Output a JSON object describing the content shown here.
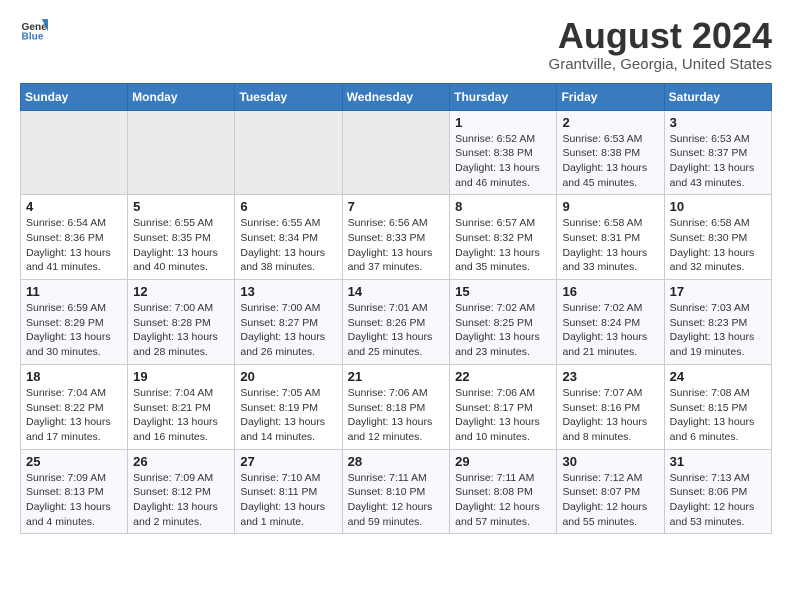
{
  "header": {
    "logo_line1": "General",
    "logo_line2": "Blue",
    "title": "August 2024",
    "subtitle": "Grantville, Georgia, United States"
  },
  "days_of_week": [
    "Sunday",
    "Monday",
    "Tuesday",
    "Wednesday",
    "Thursday",
    "Friday",
    "Saturday"
  ],
  "weeks": [
    [
      {
        "day": "",
        "info": ""
      },
      {
        "day": "",
        "info": ""
      },
      {
        "day": "",
        "info": ""
      },
      {
        "day": "",
        "info": ""
      },
      {
        "day": "1",
        "info": "Sunrise: 6:52 AM\nSunset: 8:38 PM\nDaylight: 13 hours\nand 46 minutes."
      },
      {
        "day": "2",
        "info": "Sunrise: 6:53 AM\nSunset: 8:38 PM\nDaylight: 13 hours\nand 45 minutes."
      },
      {
        "day": "3",
        "info": "Sunrise: 6:53 AM\nSunset: 8:37 PM\nDaylight: 13 hours\nand 43 minutes."
      }
    ],
    [
      {
        "day": "4",
        "info": "Sunrise: 6:54 AM\nSunset: 8:36 PM\nDaylight: 13 hours\nand 41 minutes."
      },
      {
        "day": "5",
        "info": "Sunrise: 6:55 AM\nSunset: 8:35 PM\nDaylight: 13 hours\nand 40 minutes."
      },
      {
        "day": "6",
        "info": "Sunrise: 6:55 AM\nSunset: 8:34 PM\nDaylight: 13 hours\nand 38 minutes."
      },
      {
        "day": "7",
        "info": "Sunrise: 6:56 AM\nSunset: 8:33 PM\nDaylight: 13 hours\nand 37 minutes."
      },
      {
        "day": "8",
        "info": "Sunrise: 6:57 AM\nSunset: 8:32 PM\nDaylight: 13 hours\nand 35 minutes."
      },
      {
        "day": "9",
        "info": "Sunrise: 6:58 AM\nSunset: 8:31 PM\nDaylight: 13 hours\nand 33 minutes."
      },
      {
        "day": "10",
        "info": "Sunrise: 6:58 AM\nSunset: 8:30 PM\nDaylight: 13 hours\nand 32 minutes."
      }
    ],
    [
      {
        "day": "11",
        "info": "Sunrise: 6:59 AM\nSunset: 8:29 PM\nDaylight: 13 hours\nand 30 minutes."
      },
      {
        "day": "12",
        "info": "Sunrise: 7:00 AM\nSunset: 8:28 PM\nDaylight: 13 hours\nand 28 minutes."
      },
      {
        "day": "13",
        "info": "Sunrise: 7:00 AM\nSunset: 8:27 PM\nDaylight: 13 hours\nand 26 minutes."
      },
      {
        "day": "14",
        "info": "Sunrise: 7:01 AM\nSunset: 8:26 PM\nDaylight: 13 hours\nand 25 minutes."
      },
      {
        "day": "15",
        "info": "Sunrise: 7:02 AM\nSunset: 8:25 PM\nDaylight: 13 hours\nand 23 minutes."
      },
      {
        "day": "16",
        "info": "Sunrise: 7:02 AM\nSunset: 8:24 PM\nDaylight: 13 hours\nand 21 minutes."
      },
      {
        "day": "17",
        "info": "Sunrise: 7:03 AM\nSunset: 8:23 PM\nDaylight: 13 hours\nand 19 minutes."
      }
    ],
    [
      {
        "day": "18",
        "info": "Sunrise: 7:04 AM\nSunset: 8:22 PM\nDaylight: 13 hours\nand 17 minutes."
      },
      {
        "day": "19",
        "info": "Sunrise: 7:04 AM\nSunset: 8:21 PM\nDaylight: 13 hours\nand 16 minutes."
      },
      {
        "day": "20",
        "info": "Sunrise: 7:05 AM\nSunset: 8:19 PM\nDaylight: 13 hours\nand 14 minutes."
      },
      {
        "day": "21",
        "info": "Sunrise: 7:06 AM\nSunset: 8:18 PM\nDaylight: 13 hours\nand 12 minutes."
      },
      {
        "day": "22",
        "info": "Sunrise: 7:06 AM\nSunset: 8:17 PM\nDaylight: 13 hours\nand 10 minutes."
      },
      {
        "day": "23",
        "info": "Sunrise: 7:07 AM\nSunset: 8:16 PM\nDaylight: 13 hours\nand 8 minutes."
      },
      {
        "day": "24",
        "info": "Sunrise: 7:08 AM\nSunset: 8:15 PM\nDaylight: 13 hours\nand 6 minutes."
      }
    ],
    [
      {
        "day": "25",
        "info": "Sunrise: 7:09 AM\nSunset: 8:13 PM\nDaylight: 13 hours\nand 4 minutes."
      },
      {
        "day": "26",
        "info": "Sunrise: 7:09 AM\nSunset: 8:12 PM\nDaylight: 13 hours\nand 2 minutes."
      },
      {
        "day": "27",
        "info": "Sunrise: 7:10 AM\nSunset: 8:11 PM\nDaylight: 13 hours\nand 1 minute."
      },
      {
        "day": "28",
        "info": "Sunrise: 7:11 AM\nSunset: 8:10 PM\nDaylight: 12 hours\nand 59 minutes."
      },
      {
        "day": "29",
        "info": "Sunrise: 7:11 AM\nSunset: 8:08 PM\nDaylight: 12 hours\nand 57 minutes."
      },
      {
        "day": "30",
        "info": "Sunrise: 7:12 AM\nSunset: 8:07 PM\nDaylight: 12 hours\nand 55 minutes."
      },
      {
        "day": "31",
        "info": "Sunrise: 7:13 AM\nSunset: 8:06 PM\nDaylight: 12 hours\nand 53 minutes."
      }
    ]
  ]
}
